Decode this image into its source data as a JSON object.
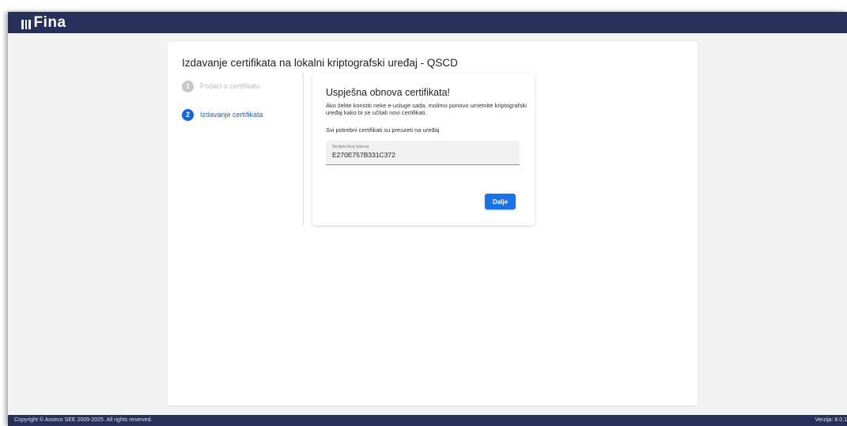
{
  "header": {
    "logo_text": "Fina"
  },
  "page": {
    "title": "Izdavanje certifikata na lokalni kriptografski uređaj - QSCD"
  },
  "stepper": {
    "steps": [
      {
        "number": "1",
        "label": "Podaci o certifikatu",
        "state": "done"
      },
      {
        "number": "2",
        "label": "Izdavanje certifikata",
        "state": "active"
      }
    ]
  },
  "result": {
    "title": "Uspješna obnova certifikata!",
    "message": "Ako želite koristiti neke e-usluge sada, molimo ponovo umetnite kriptografski uređaj kako bi se učitali novi certifikati.",
    "message2": "Svi potrebni certifikati su preuzeti na uređaj",
    "serial_field": {
      "label": "Serijski broj tokena",
      "value": "E270E757B331C372"
    },
    "next_button": "Dalje"
  },
  "footer": {
    "copyright": "Copyright © Asseco SEE 2009-2025. All rights reserved.",
    "version": "Verzija: 8.0.1"
  },
  "colors": {
    "header_bg": "#26305a",
    "accent": "#1a73e8",
    "page_bg": "#f2f2f3"
  }
}
